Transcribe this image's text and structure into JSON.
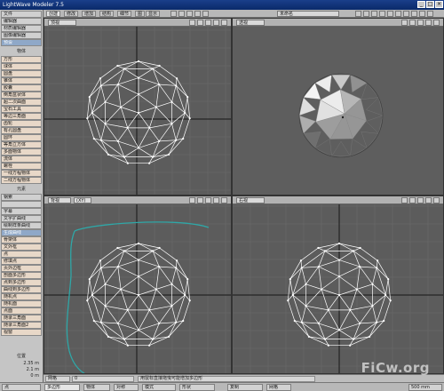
{
  "window": {
    "title": "LightWave Modeler 7.5"
  },
  "toolbar": {
    "tabs": [
      "创建",
      "修改",
      "增加",
      "结构",
      "细节",
      "图",
      "显示"
    ],
    "selected_tab": 0,
    "layer_dropdown": "未命名"
  },
  "left_panel": {
    "top_items": [
      {
        "label": "文件"
      },
      {
        "label": "编辑器"
      },
      {
        "label": "材质编辑器"
      },
      {
        "label": "图像编辑器"
      },
      {
        "label": "预设"
      }
    ],
    "section1": "物体",
    "create_items": [
      {
        "label": "方形",
        "hi": true
      },
      {
        "label": "球体",
        "hi": true
      },
      {
        "label": "圆盘",
        "hi": true
      },
      {
        "label": "锥体",
        "hi": true
      },
      {
        "label": "胶囊",
        "hi": true
      },
      {
        "label": "倒角盒状体",
        "hi": true
      },
      {
        "label": "超二次曲面",
        "hi": true
      },
      {
        "label": "宝石工具",
        "hi": true
      },
      {
        "label": "等边三角面",
        "hi": true
      },
      {
        "label": "齿轮",
        "hi": true
      },
      {
        "label": "有孔圆盘",
        "hi": true
      },
      {
        "label": "圆环",
        "hi": true
      },
      {
        "label": "等角立方体",
        "hi": true
      },
      {
        "label": "多面物体",
        "hi": true
      },
      {
        "label": "流体",
        "hi": true
      },
      {
        "label": "螺栓",
        "hi": true
      },
      {
        "label": "一线方程物体",
        "hi": true
      },
      {
        "label": "二线方程物体",
        "hi": true
      }
    ],
    "section2": "元素",
    "element_items": [
      {
        "label": "钢索",
        "hi": false,
        "sel": false
      },
      {
        "label": "",
        "hi": false,
        "sel": false
      },
      {
        "label": "字幕",
        "hi": false,
        "sel": false
      },
      {
        "label": "文字扩曲线",
        "hi": false,
        "sel": false
      },
      {
        "label": "绘制样条曲线",
        "hi": false,
        "sel": false
      },
      {
        "label": "生成曲线",
        "hi": false,
        "sel": true
      },
      {
        "label": "骨架体",
        "hi": true,
        "sel": false
      },
      {
        "label": "文外框",
        "hi": true,
        "sel": false
      },
      {
        "label": "点",
        "hi": true,
        "sel": false
      },
      {
        "label": "修填点",
        "hi": true,
        "sel": false
      },
      {
        "label": "页外边框",
        "hi": true,
        "sel": false
      },
      {
        "label": "剖面多边形",
        "hi": true,
        "sel": false
      },
      {
        "label": "点到多边形",
        "hi": true,
        "sel": false
      },
      {
        "label": "曲线到多边形",
        "hi": true,
        "sel": false
      },
      {
        "label": "随机点",
        "hi": true,
        "sel": false
      },
      {
        "label": "随机面",
        "hi": true,
        "sel": false
      },
      {
        "label": "点面",
        "hi": true,
        "sel": false
      },
      {
        "label": "随录三角面",
        "hi": true,
        "sel": false
      },
      {
        "label": "随录三角面2",
        "hi": true,
        "sel": false
      },
      {
        "label": "视窗",
        "hi": true,
        "sel": false
      }
    ],
    "position_label": "位置",
    "coords": [
      "2.35 m",
      "2.1 m",
      "0 m"
    ]
  },
  "viewports": {
    "top_left": {
      "label": "顶视"
    },
    "top_right": {
      "label": "透视"
    },
    "bottom_left": {
      "label": "背视",
      "label2": "(XY)"
    },
    "bottom_right": {
      "label": "右视"
    }
  },
  "status": {
    "left": "网格",
    "count": "0",
    "message": "用鼠标直接拖曳可能增加多边形"
  },
  "bottom_bar": [
    {
      "label": "点"
    },
    {
      "label": "多边形",
      "sel": true
    },
    {
      "label": "物体"
    },
    {
      "label": "对称"
    },
    {
      "label": "模式"
    },
    {
      "label": "形状"
    },
    {
      "label": "复制"
    },
    {
      "label": "网格"
    },
    {
      "label": "500 mm"
    }
  ],
  "watermark": "FiCw.org",
  "colors": {
    "wire": "#ffffff",
    "viewport_bg": "#5c5c5c",
    "spline": "#2fa7a7",
    "axis": "#161616"
  }
}
